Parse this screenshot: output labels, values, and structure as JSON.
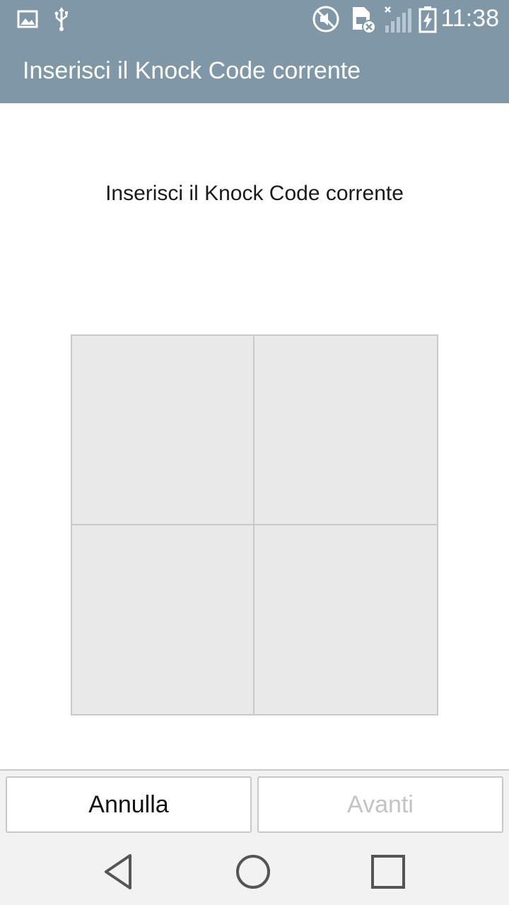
{
  "status_bar": {
    "time": "11:38",
    "icons": [
      "image-icon",
      "usb-icon",
      "mute-icon",
      "sim-error-icon",
      "signal-icon",
      "battery-charging-icon"
    ]
  },
  "header": {
    "title": "Inserisci il Knock Code corrente"
  },
  "main": {
    "instruction": "Inserisci il Knock Code corrente",
    "knock_grid": {
      "rows": 2,
      "columns": 2
    }
  },
  "buttons": {
    "cancel_label": "Annulla",
    "next_label": "Avanti"
  },
  "navigation": {
    "icons": [
      "back-icon",
      "home-icon",
      "recent-apps-icon"
    ]
  },
  "colors": {
    "header": "#7f97a7",
    "grid_fill": "#e8e9e8",
    "grid_border": "#c9cbcb",
    "disabled_text": "#c3c3c3"
  }
}
